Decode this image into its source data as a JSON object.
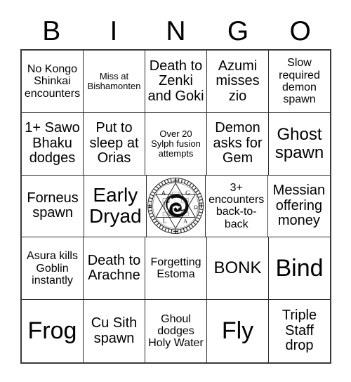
{
  "header": {
    "letters": [
      "B",
      "I",
      "N",
      "G",
      "O"
    ]
  },
  "card": {
    "rows": [
      [
        {
          "text": "No Kongo Shinkai encounters",
          "size": "sm"
        },
        {
          "text": "Miss at Bishamonten",
          "size": "xs"
        },
        {
          "text": "Death to Zenki and Goki",
          "size": "md"
        },
        {
          "text": "Azumi misses zio",
          "size": "md"
        },
        {
          "text": "Slow required demon spawn",
          "size": "sm"
        }
      ],
      [
        {
          "text": "1+ Sawo Bhaku dodges",
          "size": "md"
        },
        {
          "text": "Put to sleep at Orias",
          "size": "md"
        },
        {
          "text": "Over 20 Sylph fusion attempts",
          "size": "xs"
        },
        {
          "text": "Demon asks for Gem",
          "size": "md"
        },
        {
          "text": "Ghost spawn",
          "size": "lg"
        }
      ],
      [
        {
          "text": "Forneus spawn",
          "size": "md"
        },
        {
          "text": "Early Dryad",
          "size": "xl"
        },
        {
          "text": "",
          "size": "md",
          "free_space": true,
          "icon": "summoning-circle-seal"
        },
        {
          "text": "3+ encounters back-to-back",
          "size": "sm"
        },
        {
          "text": "Messian offering money",
          "size": "md"
        }
      ],
      [
        {
          "text": "Asura kills Goblin instantly",
          "size": "sm"
        },
        {
          "text": "Death to Arachne",
          "size": "md"
        },
        {
          "text": "Forgetting Estoma",
          "size": "sm"
        },
        {
          "text": "BONK",
          "size": "lg"
        },
        {
          "text": "Bind",
          "size": "xxl"
        }
      ],
      [
        {
          "text": "Frog",
          "size": "xxl"
        },
        {
          "text": "Cu Sith spawn",
          "size": "md"
        },
        {
          "text": "Ghoul dodges Holy Water",
          "size": "sm"
        },
        {
          "text": "Fly",
          "size": "xxl"
        },
        {
          "text": "Triple Staff drop",
          "size": "md"
        }
      ]
    ]
  },
  "free_space": {
    "icon": "summoning-circle-seal",
    "glyph_letters": [
      "A",
      "G",
      "L",
      "Ω"
    ],
    "outer_inscription": "SANCTVS DEVS SARCOSOMA SANCTVS MICHAEL"
  },
  "colors": {
    "background": "#ffffff",
    "text": "#000000",
    "grid_line": "#2b2b2b",
    "grid_outer": "#3a3a3a"
  }
}
